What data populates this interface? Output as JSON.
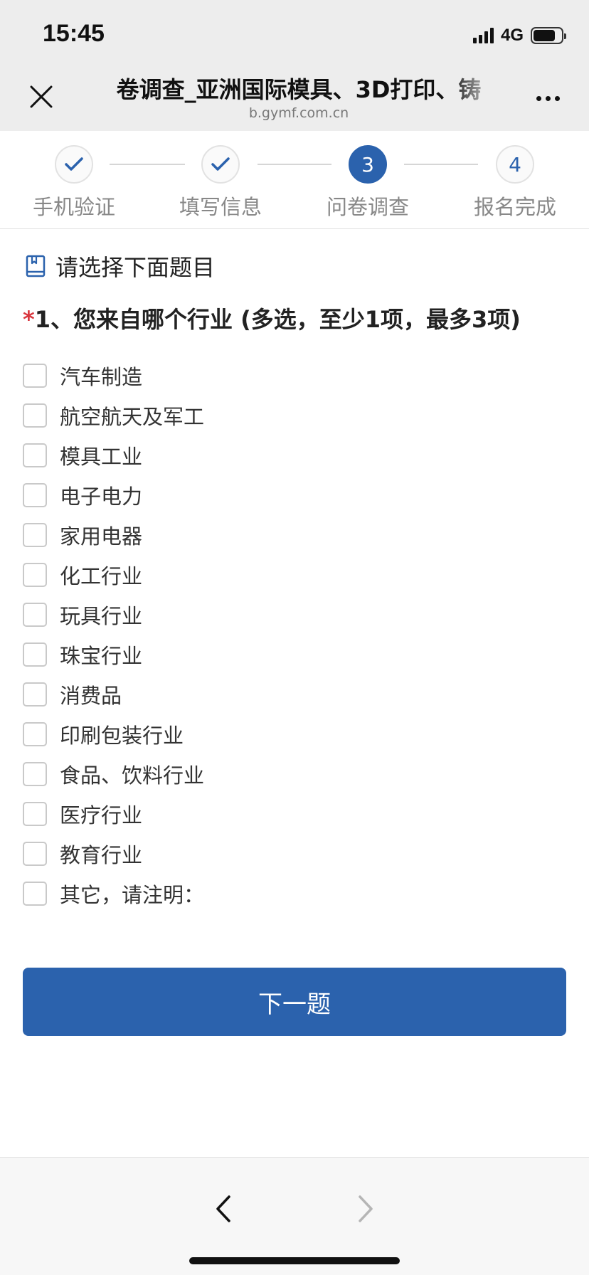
{
  "status_bar": {
    "time": "15:45",
    "network": "4G",
    "signal_bars": 4,
    "battery_level": 0.8
  },
  "nav_bar": {
    "title": "卷调查_亚洲国际模具、3D打印、铸",
    "domain": "b.gymf.com.cn",
    "close_icon": "close-icon",
    "more_icon": "more-icon"
  },
  "stepper": {
    "steps": [
      {
        "number": "1",
        "label": "手机验证",
        "state": "done"
      },
      {
        "number": "2",
        "label": "填写信息",
        "state": "done"
      },
      {
        "number": "3",
        "label": "问卷调查",
        "state": "active"
      },
      {
        "number": "4",
        "label": "报名完成",
        "state": "pending"
      }
    ]
  },
  "section": {
    "title": "请选择下面题目",
    "icon": "book-icon"
  },
  "question": {
    "required_mark": "*",
    "text": "1、您来自哪个行业 (多选，至少1项，最多3项)",
    "options": [
      "汽车制造",
      "航空航天及军工",
      "模具工业",
      "电子电力",
      "家用电器",
      "化工行业",
      "玩具行业",
      "珠宝行业",
      "消费品",
      "印刷包装行业",
      "食品、饮料行业",
      "医疗行业",
      "教育行业",
      "其它，请注明："
    ]
  },
  "actions": {
    "next_label": "下一题"
  },
  "colors": {
    "accent": "#2b62ad",
    "required": "#d9363e",
    "bar_background": "#ededed"
  }
}
